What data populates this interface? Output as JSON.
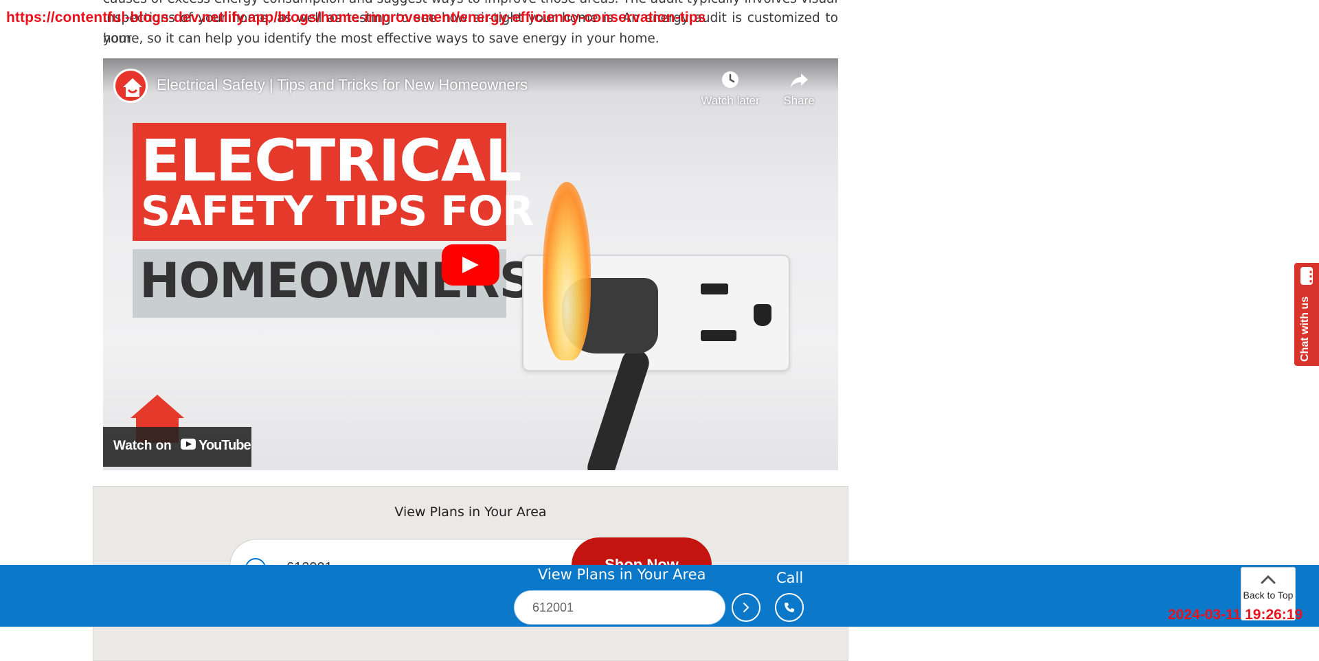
{
  "article": {
    "line1": "causes of excess energy consumption and suggest ways to improve those areas. The audit typically involves visual",
    "line2": "inspections of your home, as well as testing to see how air-tight your home is. An energy audit is customized to your",
    "line3": "home, so it can help you identify the most effective ways to save energy in your home."
  },
  "debug_url": "https://contentful-blogs-dev.netlify.app/blogs/home-improvement/energy-efficiency-conservation-tips",
  "video": {
    "title": "Electrical Safety | Tips and Tricks for New Homeowners",
    "watch_later": "Watch later",
    "share": "Share",
    "thumb_line1": "ELECTRICAL",
    "thumb_line2": "SAFETY TIPS FOR",
    "thumb_line3": "HOMEOWNERS",
    "watch_on": "Watch on",
    "youtube": "YouTube"
  },
  "plans_box": {
    "title": "View Plans in Your Area",
    "zip_value": "612001",
    "shop_button": "Shop Now"
  },
  "sticky_bar": {
    "title": "View Plans in Your Area",
    "zip_value": "612001",
    "call_label": "Call",
    "back_to_top": "Back to Top"
  },
  "chat_tab": {
    "label": "Chat with us"
  },
  "timestamp": "2024-03-11 19:26:19",
  "colors": {
    "brand_blue": "#0b78c9",
    "brand_red": "#c4140f",
    "youtube_red": "#ff0000",
    "chat_red": "#d9342b",
    "debug_red": "#e8121c"
  }
}
